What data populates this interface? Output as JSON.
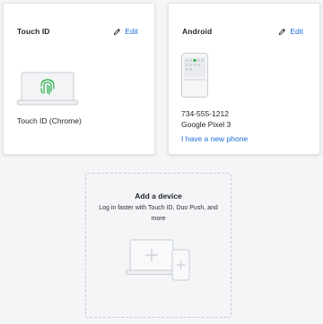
{
  "touch_id_card": {
    "title": "Touch ID",
    "edit_label": "Edit",
    "device_label": "Touch ID (Chrome)",
    "icon": "laptop-fingerprint-icon"
  },
  "android_card": {
    "title": "Android",
    "edit_label": "Edit",
    "phone_number": "734-555-1212",
    "model": "Google Pixel 3",
    "new_phone_link": "I have a new phone",
    "icon": "phone-icon"
  },
  "add_device": {
    "title": "Add a device",
    "description": "Log in faster with Touch ID, Duo Push, and more",
    "icon": "laptop-phone-plus-icon"
  },
  "colors": {
    "link": "#1a6fd6",
    "fingerprint": "#2bb24c",
    "background": "#f4f5f7"
  }
}
